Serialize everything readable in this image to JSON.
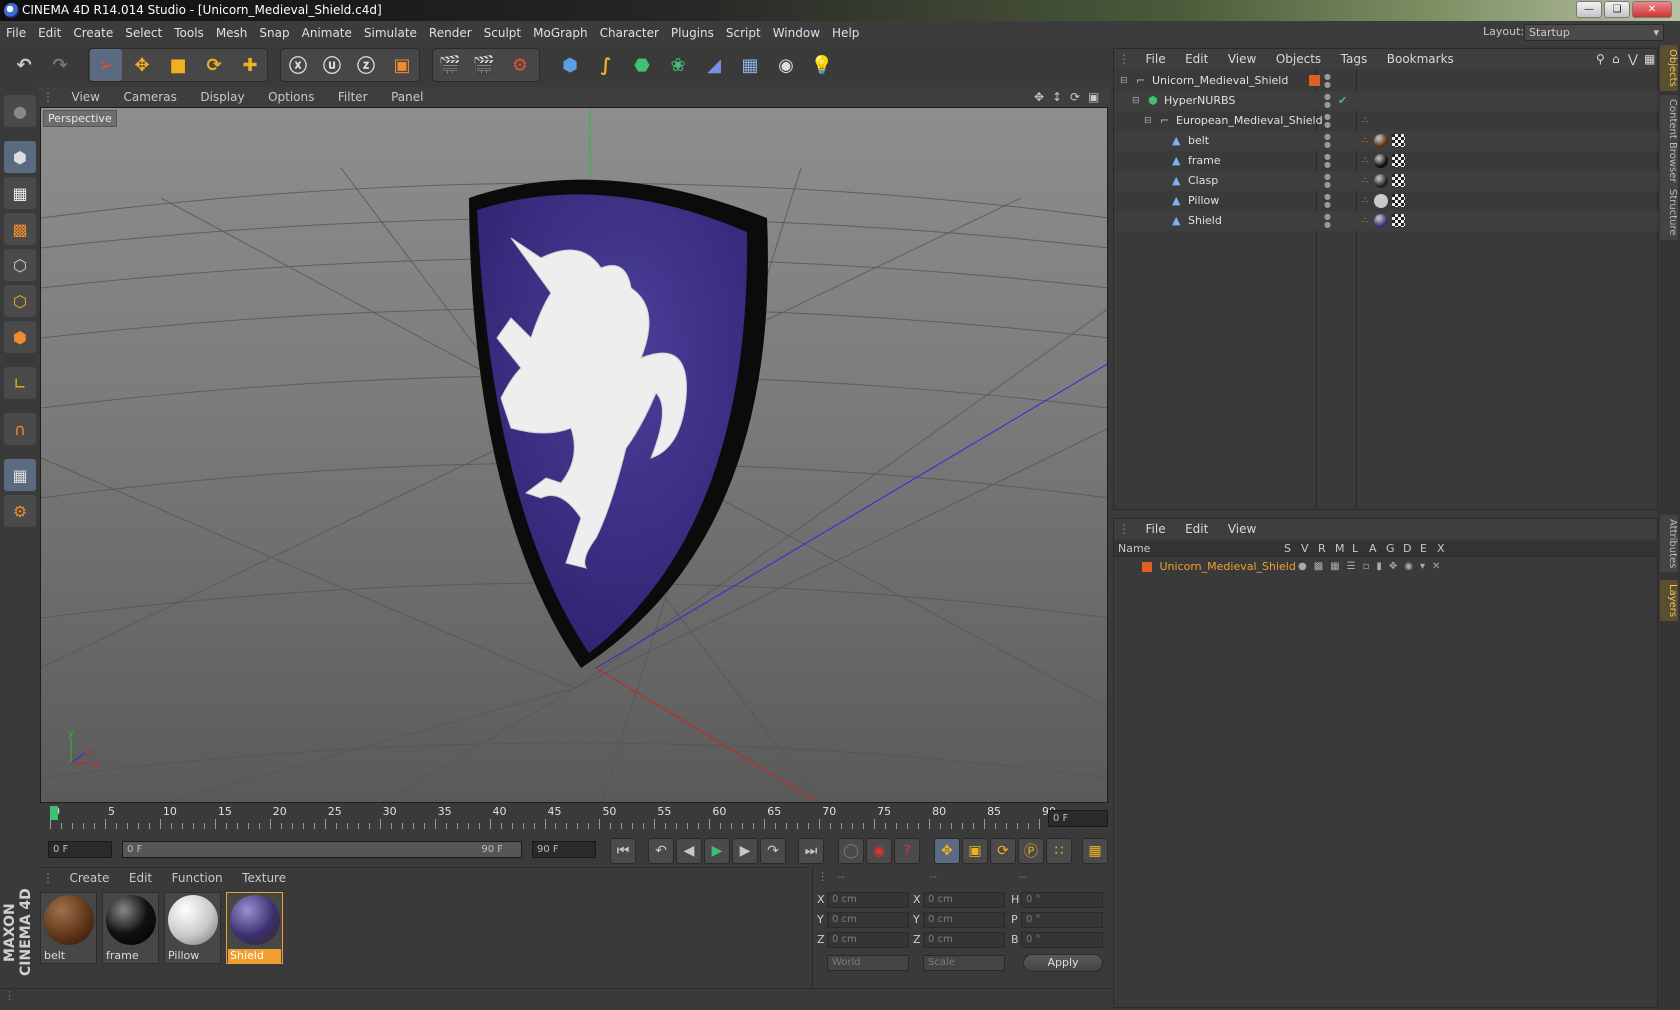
{
  "app": {
    "title": "CINEMA 4D R14.014 Studio - [Unicorn_Medieval_Shield.c4d]"
  },
  "menu": [
    "File",
    "Edit",
    "Create",
    "Select",
    "Tools",
    "Mesh",
    "Snap",
    "Animate",
    "Simulate",
    "Render",
    "Sculpt",
    "MoGraph",
    "Character",
    "Plugins",
    "Script",
    "Window",
    "Help"
  ],
  "layout": {
    "label": "Layout:",
    "value": "Startup"
  },
  "viewport": {
    "menu": [
      "View",
      "Cameras",
      "Display",
      "Options",
      "Filter",
      "Panel"
    ],
    "label": "Perspective"
  },
  "timeline": {
    "ticks": [
      "0",
      "5",
      "10",
      "15",
      "20",
      "25",
      "30",
      "35",
      "40",
      "45",
      "50",
      "55",
      "60",
      "65",
      "70",
      "75",
      "80",
      "85",
      "90"
    ],
    "current": "0 F"
  },
  "transport": {
    "start": "0 F",
    "range_start": "0 F",
    "range_end": "90 F",
    "end": "90 F"
  },
  "materials": {
    "menu": [
      "Create",
      "Edit",
      "Function",
      "Texture"
    ],
    "items": [
      {
        "name": "belt",
        "color": "#5a3216"
      },
      {
        "name": "frame",
        "color": "#111111"
      },
      {
        "name": "Pillow",
        "color": "#c8c8c8"
      },
      {
        "name": "Shield",
        "color": "#3a2f6e"
      }
    ],
    "selected": "Shield"
  },
  "coords": {
    "headers": [
      "--",
      "--",
      "--"
    ],
    "rows": [
      {
        "a": "X",
        "av": "0 cm",
        "b": "X",
        "bv": "0 cm",
        "c": "H",
        "cv": "0 °"
      },
      {
        "a": "Y",
        "av": "0 cm",
        "b": "Y",
        "bv": "0 cm",
        "c": "P",
        "cv": "0 °"
      },
      {
        "a": "Z",
        "av": "0 cm",
        "b": "Z",
        "bv": "0 cm",
        "c": "B",
        "cv": "0 °"
      }
    ],
    "world": "World",
    "scale": "Scale",
    "apply": "Apply"
  },
  "objects": {
    "menu": [
      "File",
      "Edit",
      "View",
      "Objects",
      "Tags",
      "Bookmarks"
    ],
    "tree": [
      {
        "name": "Unicorn_Medieval_Shield",
        "indent": 0,
        "icon": "null"
      },
      {
        "name": "HyperNURBS",
        "indent": 1,
        "icon": "nurbs"
      },
      {
        "name": "European_Medieval_Shield",
        "indent": 2,
        "icon": "null"
      },
      {
        "name": "belt",
        "indent": 3,
        "icon": "poly"
      },
      {
        "name": "frame",
        "indent": 3,
        "icon": "poly"
      },
      {
        "name": "Clasp",
        "indent": 3,
        "icon": "poly"
      },
      {
        "name": "Pillow",
        "indent": 3,
        "icon": "poly"
      },
      {
        "name": "Shield",
        "indent": 3,
        "icon": "poly"
      }
    ]
  },
  "layers": {
    "menu": [
      "File",
      "Edit",
      "View"
    ],
    "columns": [
      "Name",
      "S",
      "V",
      "R",
      "M",
      "L",
      "A",
      "G",
      "D",
      "E",
      "X"
    ],
    "rows": [
      {
        "name": "Unicorn_Medieval_Shield"
      }
    ]
  },
  "side_tabs": [
    "Objects",
    "Content Browser",
    "Structure",
    "Attributes",
    "Layers"
  ],
  "brand": "MAXON CINEMA 4D"
}
